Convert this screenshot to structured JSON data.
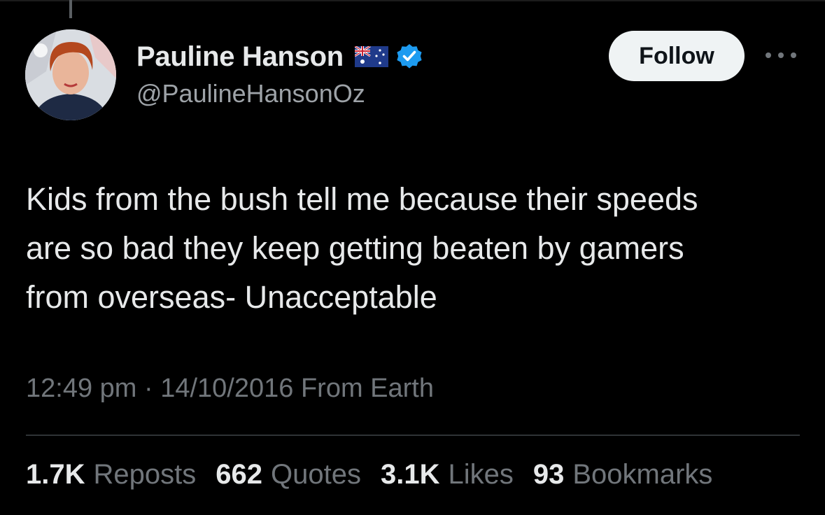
{
  "author": {
    "display_name": "Pauline Hanson",
    "handle": "@PaulineHansonOz",
    "flag_icon": "australia-flag-icon",
    "verified_icon": "verified-badge-icon",
    "verified_color": "#1d9bf0"
  },
  "actions": {
    "follow_label": "Follow",
    "more_icon": "more-options-icon"
  },
  "tweet": {
    "text": "Kids from the bush tell me because their speeds\nare so bad they keep getting beaten by gamers\nfrom overseas- Unacceptable",
    "timestamp": "12:49 pm · 14/10/2016 From Earth"
  },
  "stats": [
    {
      "value": "1.7K",
      "label": "Reposts"
    },
    {
      "value": "662",
      "label": "Quotes"
    },
    {
      "value": "3.1K",
      "label": "Likes"
    },
    {
      "value": "93",
      "label": "Bookmarks"
    }
  ],
  "colors": {
    "background": "#000000",
    "text_primary": "#e7e9ea",
    "text_secondary": "#71767b",
    "follow_button_bg": "#eff3f4",
    "divider": "#2f3336"
  }
}
